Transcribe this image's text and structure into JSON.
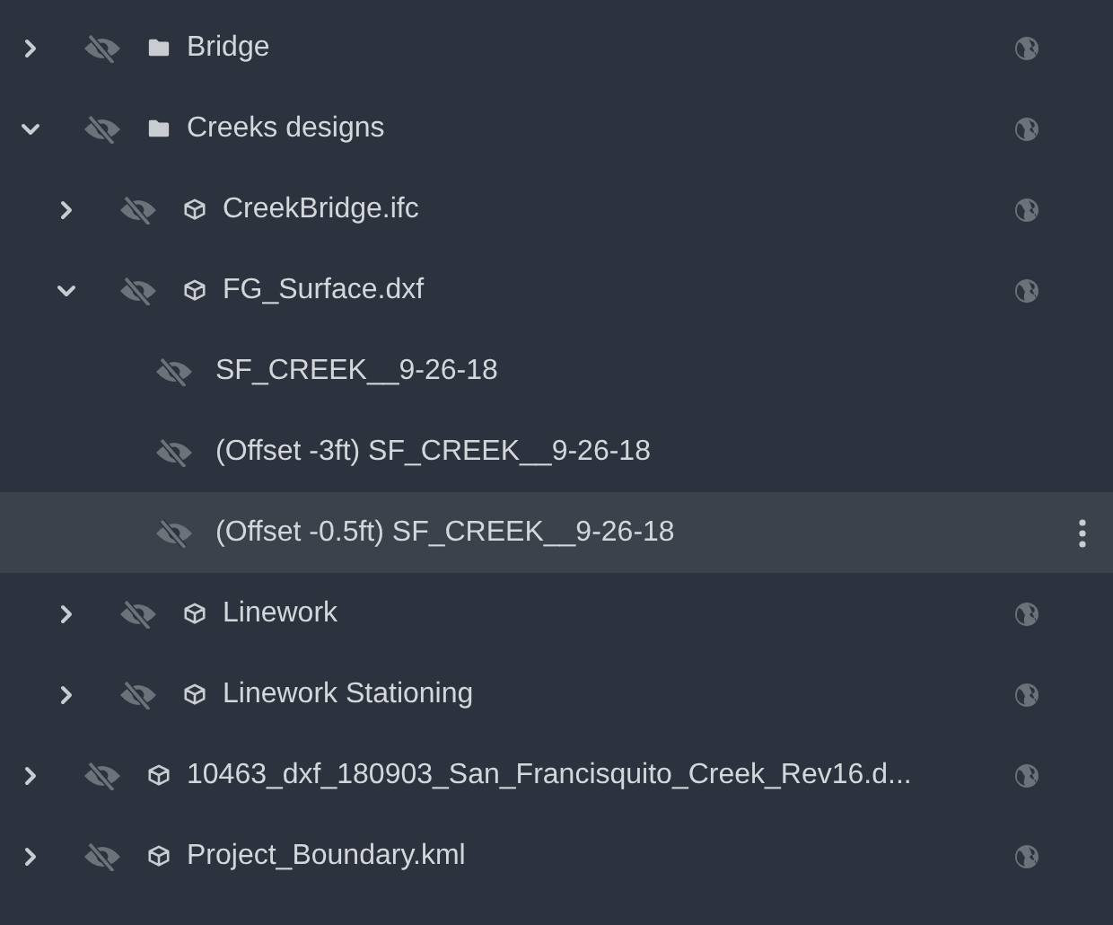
{
  "tree": [
    {
      "kind": "folder",
      "label": "Bridge",
      "expanded": false,
      "visible": false,
      "selected": false
    },
    {
      "kind": "folder",
      "label": "Creeks designs",
      "expanded": true,
      "visible": false,
      "selected": false,
      "children": [
        {
          "kind": "model",
          "label": "CreekBridge.ifc",
          "expanded": false,
          "visible": false,
          "selected": false
        },
        {
          "kind": "model",
          "label": "FG_Surface.dxf",
          "expanded": true,
          "visible": false,
          "selected": false,
          "children": [
            {
              "kind": "layer",
              "label": "SF_CREEK__9-26-18",
              "visible": false,
              "selected": false
            },
            {
              "kind": "layer",
              "label": "(Offset -3ft) SF_CREEK__9-26-18",
              "visible": false,
              "selected": false
            },
            {
              "kind": "layer",
              "label": "(Offset -0.5ft) SF_CREEK__9-26-18",
              "visible": false,
              "selected": true
            }
          ]
        },
        {
          "kind": "model",
          "label": "Linework",
          "expanded": false,
          "visible": false,
          "selected": false
        },
        {
          "kind": "model",
          "label": "Linework Stationing",
          "expanded": false,
          "visible": false,
          "selected": false
        }
      ]
    },
    {
      "kind": "model",
      "label": "10463_dxf_180903_San_Francisquito_Creek_Rev16.d...",
      "expanded": false,
      "visible": false,
      "selected": false
    },
    {
      "kind": "model",
      "label": "Project_Boundary.kml",
      "expanded": false,
      "visible": false,
      "selected": false
    }
  ]
}
